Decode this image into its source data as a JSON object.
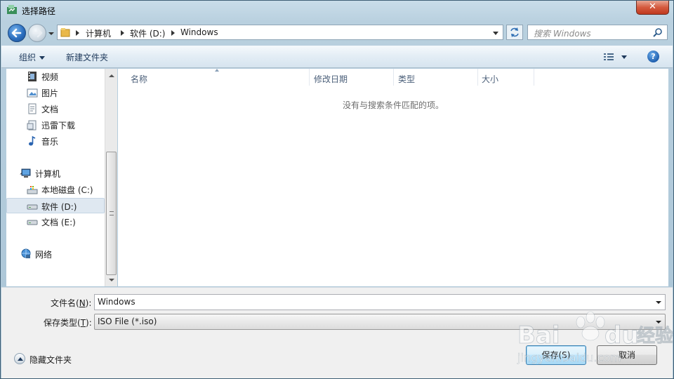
{
  "window": {
    "title": "选择路径",
    "close_symbol": "✕"
  },
  "address": {
    "crumbs": [
      "计算机",
      "软件 (D:)",
      "Windows"
    ]
  },
  "search": {
    "placeholder": "搜索 Windows"
  },
  "toolbar": {
    "organize_label": "组织",
    "new_folder_label": "新建文件夹",
    "help_symbol": "?"
  },
  "nav": {
    "items": [
      {
        "label": "视频",
        "icon": "video-icon"
      },
      {
        "label": "图片",
        "icon": "pictures-icon"
      },
      {
        "label": "文档",
        "icon": "documents-icon"
      },
      {
        "label": "迅雷下载",
        "icon": "download-folder-icon"
      },
      {
        "label": "音乐",
        "icon": "music-icon"
      },
      {
        "label": "计算机",
        "icon": "computer-icon"
      },
      {
        "label": "本地磁盘 (C:)",
        "icon": "system-drive-icon"
      },
      {
        "label": "软件 (D:)",
        "icon": "drive-icon",
        "selected": true
      },
      {
        "label": "文档 (E:)",
        "icon": "drive-icon"
      },
      {
        "label": "网络",
        "icon": "network-icon"
      }
    ]
  },
  "columns": [
    "名称",
    "修改日期",
    "类型",
    "大小"
  ],
  "empty_message": "没有与搜索条件匹配的项。",
  "form": {
    "filename_label": "文件名(",
    "filename_key": "N",
    "filename_suffix": "):",
    "filename_value": "Windows",
    "filetype_label": "保存类型(",
    "filetype_key": "T",
    "filetype_suffix": "):",
    "filetype_value": "ISO File (*.iso)"
  },
  "footer": {
    "hide_folders_label": "隐藏文件夹",
    "save_label": "保存(S)",
    "cancel_label": "取消"
  },
  "watermark": {
    "brand": "Bai",
    "brand2": "du",
    "suffix": "经验",
    "url": "jingyan.baidu.com"
  },
  "colors": {
    "accent": "#1e395b",
    "selection": "#dfe8f1",
    "titlebar": "#c9dde9",
    "close": "#c03a1f"
  }
}
